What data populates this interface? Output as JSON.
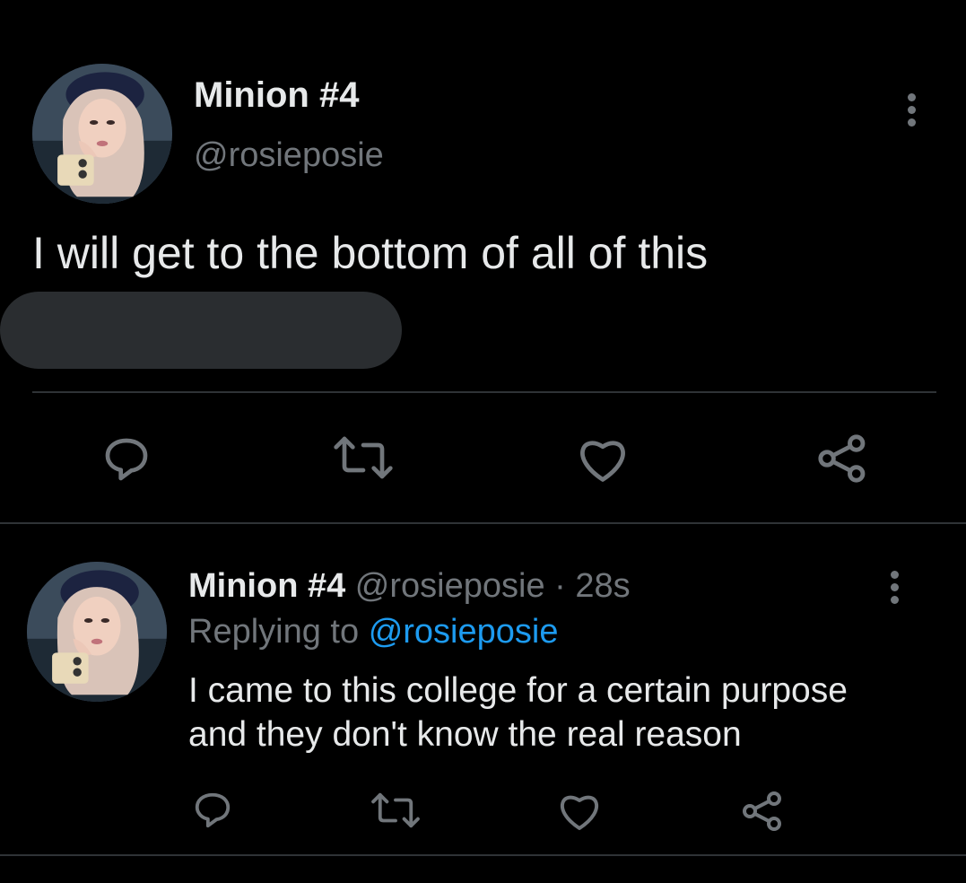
{
  "main_tweet": {
    "display_name": "Minion #4",
    "handle": "@rosieposie",
    "text": "I will get to the bottom of all of this"
  },
  "reply_tweet": {
    "display_name": "Minion #4",
    "handle": "@rosieposie",
    "separator": "·",
    "timestamp": "28s",
    "replying_label": "Replying to",
    "replying_to": "@rosieposie",
    "text_line1": "I came to this college for a certain purpose",
    "text_line2": "and they don't know the real reason"
  },
  "icons": {
    "reply": "reply-icon",
    "retweet": "retweet-icon",
    "like": "heart-icon",
    "share": "share-icon",
    "more": "more-icon"
  },
  "colors": {
    "background": "#000000",
    "text": "#e7e9ea",
    "secondary": "#71767b",
    "link": "#1d9bf0",
    "divider": "#2f3336"
  }
}
